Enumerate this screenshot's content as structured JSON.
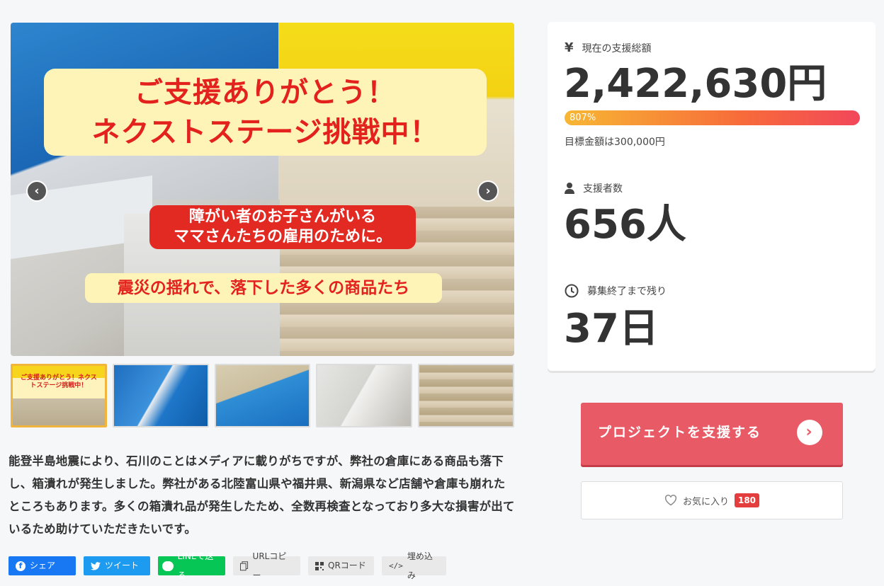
{
  "hero": {
    "banner_line1": "ご支援ありがとう！",
    "banner_line2": "ネクストステージ挑戦中！",
    "sub_line1": "障がい者のお子さんがいる",
    "sub_line2": "ママさんたちの雇用のために。",
    "caption": "震災の揺れで、落下した多くの商品たち",
    "prev_icon": "chevron-left-icon",
    "next_icon": "chevron-right-icon"
  },
  "thumbnails": [
    {
      "label": "ご支援ありがとう！ネクストステージ挑戦中！",
      "active": true
    },
    {
      "label": "",
      "active": false
    },
    {
      "label": "",
      "active": false
    },
    {
      "label": "",
      "active": false
    },
    {
      "label": "",
      "active": false
    }
  ],
  "description": "能登半島地震により、石川のことはメディアに載りがちですが、弊社の倉庫にある商品も落下し、箱潰れが発生しました。弊社がある北陸富山県や福井県、新潟県など店舗や倉庫も崩れたところもあります。多くの箱潰れ品が発生したため、全数再検査となっており多大な損害が出ているため助けていただきたいです。",
  "share": {
    "facebook": "シェア",
    "twitter": "ツイート",
    "line": "LINEで送る",
    "url": "URLコピー",
    "qr": "QRコード",
    "embed": "埋め込み"
  },
  "stats": {
    "amount_label": "現在の支援総額",
    "amount": "2,422,630円",
    "progress_label": "807%",
    "progress_percent": 807,
    "goal": "目標金額は300,000円",
    "supporters_label": "支援者数",
    "supporters": "656人",
    "remaining_label": "募集終了まで残り",
    "remaining": "37日"
  },
  "actions": {
    "support_label": "プロジェクトを支援する",
    "favorite_label": "お気に入り",
    "favorite_count": "180"
  },
  "colors": {
    "support_button": "#e85a66",
    "progress_start": "#f7b733",
    "progress_end": "#f2475a",
    "favorite_badge": "#e43d3d"
  }
}
